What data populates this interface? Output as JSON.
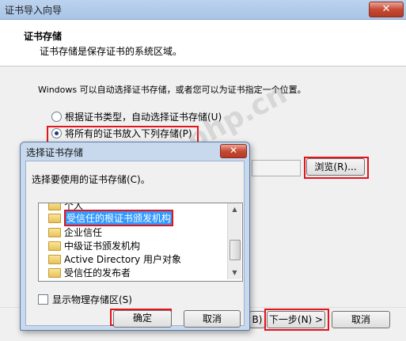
{
  "wizard": {
    "title": "证书导入向导",
    "close_glyph": "✕",
    "header_title": "证书存储",
    "header_subtitle": "证书存储是保存证书的系统区域。",
    "description": "Windows 可以自动选择证书存储，或者您可以为证书指定一个位置。",
    "radio_auto": "根据证书类型，自动选择证书存储(U)",
    "radio_manual": "将所有的证书放入下列存储(P)",
    "radio_selected": "manual",
    "browse_label": "浏览(R)...",
    "back_fragment": "B)",
    "next_label": "下一步(N) >",
    "cancel_label": "取消",
    "watermark": "php.cn"
  },
  "dialog": {
    "title": "选择证书存储",
    "close_glyph": "✕",
    "prompt": "选择要使用的证书存储(C)。",
    "stores": [
      {
        "label": "个人",
        "selected": false
      },
      {
        "label": "受信任的根证书颁发机构",
        "selected": true
      },
      {
        "label": "企业信任",
        "selected": false
      },
      {
        "label": "中级证书颁发机构",
        "selected": false
      },
      {
        "label": "Active Directory 用户对象",
        "selected": false
      },
      {
        "label": "受信任的发布者",
        "selected": false
      }
    ],
    "show_physical_label": "显示物理存储区(S)",
    "show_physical_checked": false,
    "ok_label": "确定",
    "cancel_label": "取消",
    "scroll_up": "▲",
    "scroll_down": "▼"
  },
  "colors": {
    "highlight_red": "#e2141c",
    "selection_blue": "#3399ff"
  }
}
